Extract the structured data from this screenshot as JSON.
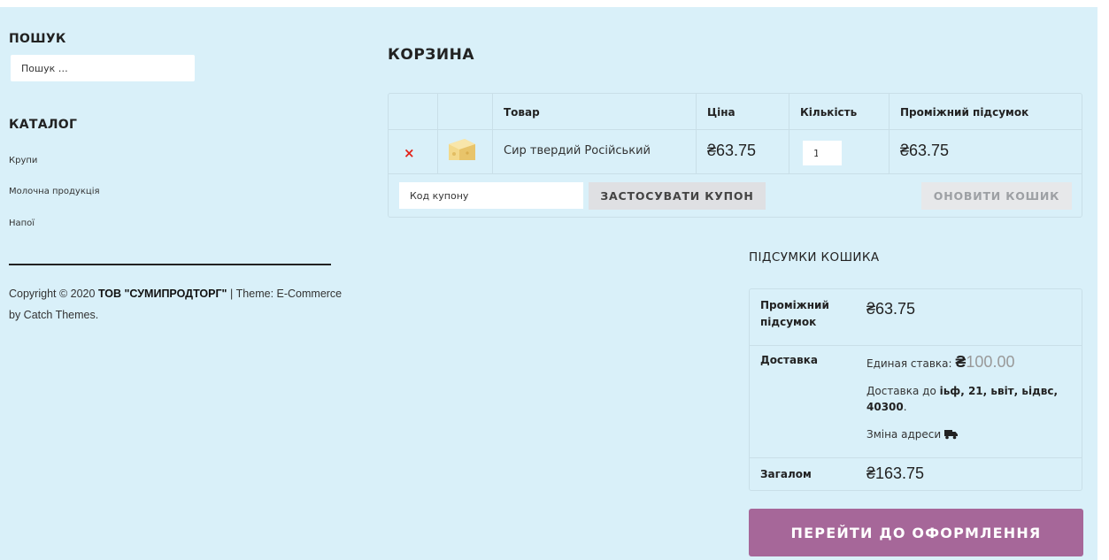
{
  "sidebar": {
    "search": {
      "title": "ПОШУК",
      "placeholder": "Пошук …"
    },
    "catalog": {
      "title": "КАТАЛОГ",
      "items": [
        "Крупи",
        "Молочна продукція",
        "Напої"
      ]
    },
    "footer": {
      "copyright_prefix": "Copyright © 2020 ",
      "company": "ТОВ \"СУМИПРОДТОРГ\"",
      "theme_text": " | Theme: E-Commerce by Catch Themes."
    }
  },
  "cart": {
    "title": "КОРЗИНА",
    "headers": {
      "product": "Товар",
      "price": "Ціна",
      "quantity": "Кількість",
      "subtotal": "Проміжний підсумок"
    },
    "items": [
      {
        "remove_symbol": "×",
        "thumbnail": "cheese-thumbnail",
        "name": "Сир твердий Російський",
        "price": "₴63.75",
        "quantity": "1",
        "subtotal": "₴63.75"
      }
    ],
    "coupon_placeholder": "Код купону",
    "apply_coupon_label": "ЗАСТОСУВАТИ КУПОН",
    "update_cart_label": "ОНОВИТИ КОШИК"
  },
  "totals": {
    "title": "ПІДСУМКИ КОШИКА",
    "subtotal_label": "Проміжний підсумок",
    "subtotal_value": "₴63.75",
    "shipping_label": "Доставка",
    "shipping_rate_prefix": "Единая ставка: ",
    "shipping_currency": "₴",
    "shipping_amount": "100.00",
    "shipping_dest_prefix": "Доставка до ",
    "shipping_address": "іьф, 21, ьвіт, ьідвс, 40300",
    "shipping_dest_suffix": ".",
    "change_address_label": "Зміна адреси",
    "total_label": "Загалом",
    "total_value": "₴163.75",
    "checkout_label": "ПЕРЕЙТИ ДО ОФОРМЛЕННЯ"
  },
  "colors": {
    "page_background": "#d9f0f9",
    "checkout_button": "#a66799",
    "remove_icon": "#e2231a"
  }
}
